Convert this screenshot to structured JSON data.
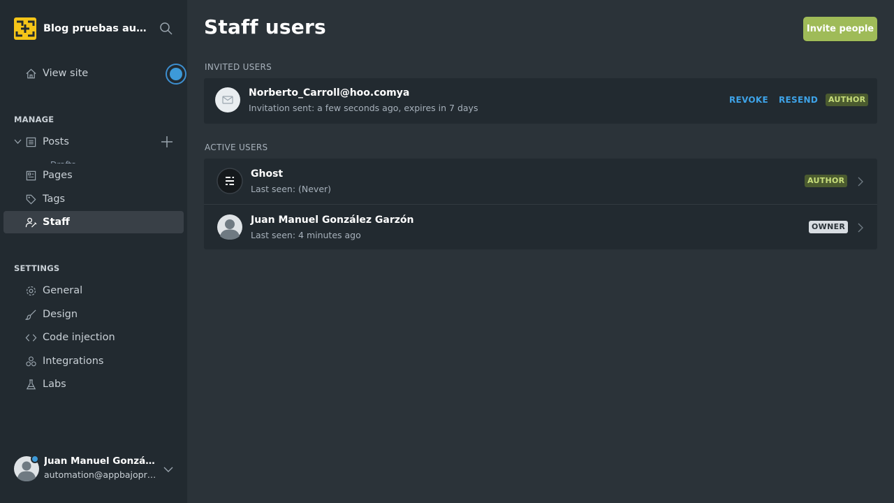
{
  "brand": {
    "name": "Blog pruebas auto..."
  },
  "sidebar": {
    "view_site": "View site",
    "manage_title": "MANAGE",
    "posts": "Posts",
    "posts_peek": "Drafts",
    "pages": "Pages",
    "tags": "Tags",
    "staff": "Staff",
    "settings_title": "SETTINGS",
    "general": "General",
    "design": "Design",
    "code_injection": "Code injection",
    "integrations": "Integrations",
    "labs": "Labs"
  },
  "current_user": {
    "name": "Juan Manuel Gonzále...",
    "email": "automation@appbajopru..."
  },
  "page": {
    "title": "Staff users",
    "invite_button": "Invite people"
  },
  "invited": {
    "title": "INVITED USERS",
    "users": [
      {
        "email": "Norberto_Carroll@hoo.comya",
        "meta": "Invitation sent: a few seconds ago, expires in 7 days",
        "revoke": "REVOKE",
        "resend": "RESEND",
        "role": "AUTHOR"
      }
    ]
  },
  "active": {
    "title": "ACTIVE USERS",
    "users": [
      {
        "name": "Ghost",
        "meta": "Last seen: (Never)",
        "role": "AUTHOR"
      },
      {
        "name": "Juan Manuel González Garzón",
        "meta": "Last seen: 4 minutes ago",
        "role": "OWNER"
      }
    ]
  },
  "colors": {
    "sidebar_bg": "#222a30",
    "main_bg": "#2b3339",
    "accent_green": "#9fbb58",
    "link_blue": "#3ea3e8",
    "author_badge": "#4b5b2f",
    "owner_badge": "#d8dde2"
  }
}
